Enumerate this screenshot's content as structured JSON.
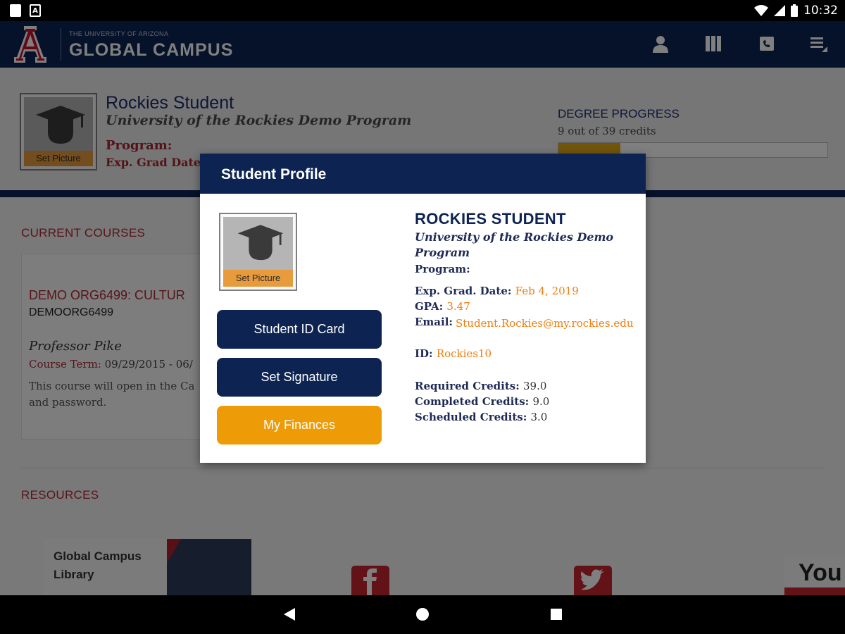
{
  "status_bar": {
    "time": "10:32"
  },
  "header": {
    "university_name": "THE UNIVERSITY OF ARIZONA",
    "campus_name": "GLOBAL CAMPUS",
    "icons": [
      "person-icon",
      "library-icon",
      "contact-icon",
      "menu-icon"
    ]
  },
  "profile": {
    "name": "Rockies Student",
    "school": "University of the Rockies Demo Program",
    "program_label": "Program:",
    "grad_label": "Exp. Grad Date:",
    "set_picture": "Set Picture",
    "degree_progress": {
      "title": "DEGREE PROGRESS",
      "subtitle": "9 out of 39 credits",
      "fraction": 0.231
    }
  },
  "current_courses": {
    "title": "CURRENT COURSES",
    "course": {
      "title": "DEMO ORG6499: CULTUR",
      "code": "DEMOORG6499",
      "professor": "Professor Pike",
      "term_label": "Course Term:",
      "term_value": "09/29/2015 - 06/",
      "description_line1": "This course will open in the Ca",
      "description_line2": "and password."
    }
  },
  "resources": {
    "title": "RESOURCES",
    "library_line1": "Global Campus",
    "library_line2": "Library",
    "youtube_text": "You"
  },
  "dialog": {
    "title": "Student Profile",
    "set_picture": "Set Picture",
    "buttons": {
      "student_id_card": "Student ID Card",
      "set_signature": "Set Signature",
      "my_finances": "My Finances"
    },
    "name": "ROCKIES STUDENT",
    "school": "University of the Rockies Demo Program",
    "program_label": "Program:",
    "grad_label": "Exp. Grad. Date:",
    "grad_value": "Feb 4, 2019",
    "gpa_label": "GPA:",
    "gpa_value": "3.47",
    "email_label": "Email:",
    "email_value": "Student.Rockies@my.rockies.edu",
    "id_label": "ID:",
    "id_value": "Rockies10",
    "required_label": "Required Credits:",
    "required_value": "39.0",
    "completed_label": "Completed Credits:",
    "completed_value": "9.0",
    "scheduled_label": "Scheduled Credits:",
    "scheduled_value": "3.0"
  },
  "colors": {
    "navy": "#0d2452",
    "red": "#b12833",
    "orange": "#ed9b06",
    "accent_value": "#ef7d0e"
  }
}
